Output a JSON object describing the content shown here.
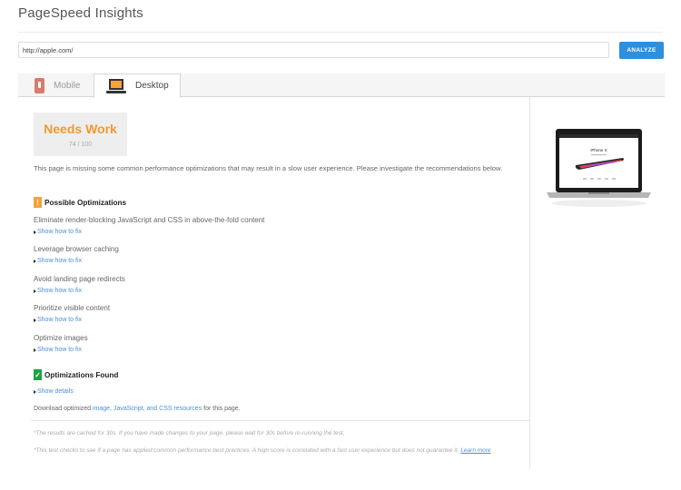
{
  "app": {
    "title": "PageSpeed Insights"
  },
  "search": {
    "value": "http://apple.com/",
    "analyze_label": "ANALYZE"
  },
  "tabs": [
    {
      "label": "Mobile",
      "icon": "mobile-phone-icon"
    },
    {
      "label": "Desktop",
      "icon": "laptop-icon"
    }
  ],
  "score": {
    "label": "Needs Work",
    "value": "74 / 100",
    "color": "#f09a2f"
  },
  "summary": "This page is missing some common performance optimizations that may result in a slow user experience. Please investigate the recommendations below.",
  "possible": {
    "heading": "Possible Optimizations",
    "badge": "!",
    "items": [
      {
        "title": "Eliminate render-blocking JavaScript and CSS in above-the-fold content",
        "link": "Show how to fix"
      },
      {
        "title": "Leverage browser caching",
        "link": "Show how to fix"
      },
      {
        "title": "Avoid landing page redirects",
        "link": "Show how to fix"
      },
      {
        "title": "Prioritize visible content",
        "link": "Show how to fix"
      },
      {
        "title": "Optimize images",
        "link": "Show how to fix"
      }
    ]
  },
  "found": {
    "heading": "Optimizations Found",
    "link": "Show details"
  },
  "download": {
    "prefix": "Download optimized ",
    "link": "image, JavaScript, and CSS resources",
    "suffix": " for this page."
  },
  "notes": {
    "cache": "*The results are cached for 30s. If you have made changes to your page, please wait for 30s before re-running the test.",
    "test": "*This test checks to see if a page has applied common performance best practices. A high score is correlated with a fast user experience but does not guarantee it. ",
    "learn_more": "Learn more"
  },
  "preview": {
    "heading": "iPhone X"
  },
  "colors": {
    "accent": "#2f8fdb",
    "warning": "#f3a33a",
    "success": "#1ea240",
    "link": "#4a90d9"
  }
}
